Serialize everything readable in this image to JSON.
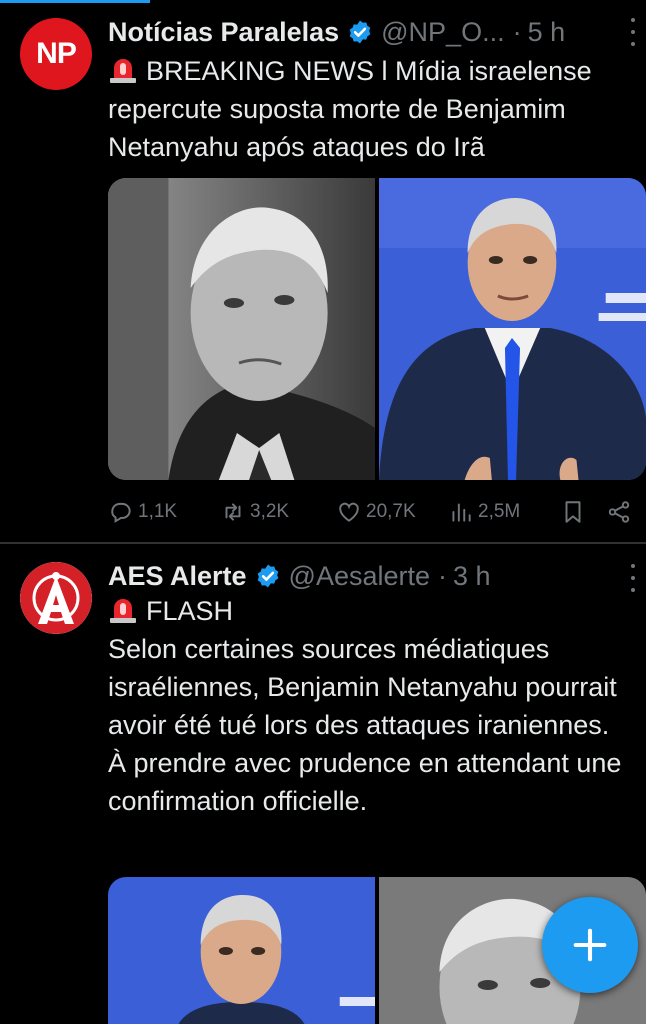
{
  "tweets": [
    {
      "name": "Notícias Paralelas",
      "handle": "@NP_O...",
      "time": "5 h",
      "avatar_text": "NP",
      "text": "BREAKING NEWS l Mídia israelense repercute suposta morte de Benjamim Netanyahu após ataques do Irã",
      "stats": {
        "replies": "1,1K",
        "reposts": "3,2K",
        "likes": "20,7K",
        "views": "2,5M"
      }
    },
    {
      "name": "AES Alerte",
      "handle": "@Aesalerte",
      "time": "3 h",
      "text_lines": [
        "FLASH",
        "Selon certaines sources médiatiques israéliennes, Benjamin Netanyahu pourrait avoir été tué lors des attaques iraniennes.",
        "À prendre avec prudence en attendant une confirmation officielle."
      ]
    }
  ],
  "separator": "·",
  "colors": {
    "accent": "#1d9bf0",
    "muted": "#71767b",
    "text": "#e7e9ea",
    "np_red": "#e0161e",
    "aes_red": "#d42027"
  },
  "icons": [
    "siren-emoji-icon",
    "verified-badge-icon",
    "reply-icon",
    "repost-icon",
    "like-icon",
    "views-icon",
    "bookmark-icon",
    "share-icon",
    "more-icon",
    "compose-plus-icon"
  ]
}
